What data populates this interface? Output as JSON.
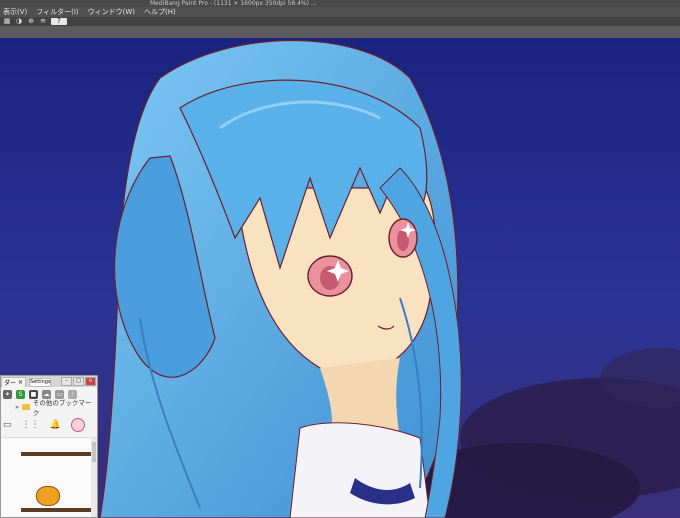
{
  "window": {
    "title": "MediBang Paint Pro  -  (1131 × 1600px 350dpi 58.4%)  ..."
  },
  "menubar": {
    "items": [
      "表示(V)",
      "フィルター(I)",
      "ウィンドウ(W)",
      "ヘルプ(H)"
    ]
  },
  "command_bar": {
    "icons": [
      "grid-icon",
      "contrast-icon",
      "info-icon",
      "layers-icon",
      "help-icon"
    ]
  },
  "browser": {
    "tab_label": "ダー",
    "new_tab_label": "Settings",
    "bookmark_label": "その他のブックマーク",
    "bookmark_more": "»"
  },
  "colors": {
    "sky_dark": "#1b237a",
    "sky_mid": "#2a3496",
    "hair": "#5ab0e8",
    "hair_shadow": "#3d86c9",
    "skin": "#f8e2c0",
    "eye": "#e9919c",
    "outline": "#6b2030"
  }
}
